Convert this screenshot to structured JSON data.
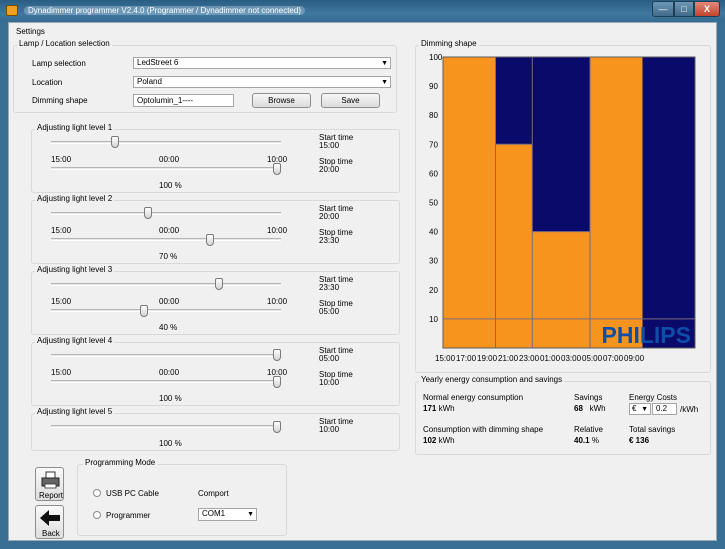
{
  "window": {
    "title": "Dynadimmer programmer V2.4.0  (Programmer / Dynadimmer not connected)",
    "controls": {
      "minimize": "—",
      "maximize": "□",
      "close": "X"
    }
  },
  "menu": {
    "settings": "Settings"
  },
  "lamp": {
    "group_title": "Lamp / Location selection",
    "lamp_label": "Lamp selection",
    "lamp_value": "LedStreet 6",
    "location_label": "Location",
    "location_value": "Poland",
    "shape_label": "Dimming shape",
    "shape_value": "Optolumin_1----",
    "browse": "Browse",
    "save": "Save"
  },
  "levels": [
    {
      "title": "Adjusting light level 1",
      "scale_left": "15:00",
      "scale_mid": "00:00",
      "scale_right": "10:00",
      "start_label": "Start time",
      "start": "15:00",
      "stop_label": "Stop time",
      "stop": "20:00",
      "percent": "100",
      "unit": "%",
      "time_pos": 0.27,
      "level_pos": 1.0
    },
    {
      "title": "Adjusting light level 2",
      "scale_left": "15:00",
      "scale_mid": "00:00",
      "scale_right": "10:00",
      "start_label": "Start time",
      "start": "20:00",
      "stop_label": "Stop time",
      "stop": "23:30",
      "percent": "70",
      "unit": "%",
      "time_pos": 0.42,
      "level_pos": 0.7
    },
    {
      "title": "Adjusting light level 3",
      "scale_left": "15:00",
      "scale_mid": "00:00",
      "scale_right": "10:00",
      "start_label": "Start time",
      "start": "23:30",
      "stop_label": "Stop time",
      "stop": "05:00",
      "percent": "40",
      "unit": "%",
      "time_pos": 0.74,
      "level_pos": 0.4
    },
    {
      "title": "Adjusting light level 4",
      "scale_left": "15:00",
      "scale_mid": "00:00",
      "scale_right": "10:00",
      "start_label": "Start time",
      "start": "05:00",
      "stop_label": "Stop time",
      "stop": "10:00",
      "percent": "100",
      "unit": "%",
      "time_pos": 1.0,
      "level_pos": 1.0
    },
    {
      "title": "Adjusting light level 5",
      "start_label": "Start time",
      "start": "10:00",
      "percent": "100",
      "unit": "%",
      "level_pos": 1.0
    }
  ],
  "programming": {
    "group_title": "Programming Mode",
    "usb": "USB PC Cable",
    "comport_label": "Comport",
    "programmer": "Programmer",
    "comport_value": "COM1",
    "report": "Report",
    "back": "Back"
  },
  "chart": {
    "group_title": "Dimming shape",
    "logo": "PHILIPS",
    "colors": {
      "orange": "#f7941d",
      "navy": "#0a0a6b",
      "line": "#7a6a80"
    }
  },
  "chart_data": {
    "type": "area",
    "x": [
      "15:00",
      "17:00",
      "19:00",
      "21:00",
      "23:00",
      "01:00",
      "03:00",
      "05:00",
      "07:00",
      "09:00"
    ],
    "y_ticks": [
      10,
      20,
      30,
      40,
      50,
      60,
      70,
      80,
      90,
      100
    ],
    "ylim": [
      0,
      100
    ],
    "segments": [
      {
        "start": "15:00",
        "stop": "20:00",
        "level": 100
      },
      {
        "start": "20:00",
        "stop": "23:30",
        "level": 70
      },
      {
        "start": "23:30",
        "stop": "05:00",
        "level": 40
      },
      {
        "start": "05:00",
        "stop": "10:00",
        "level": 100
      }
    ]
  },
  "energy": {
    "group_title": "Yearly energy consumption and savings",
    "normal_label": "Normal energy consumption",
    "normal_value": "171",
    "normal_unit": "kWh",
    "savings_label": "Savings",
    "savings_value": "68",
    "savings_unit": "kWh",
    "costs_label": "Energy Costs",
    "currency": "€",
    "cost_value": "0.2",
    "cost_unit": "/kWh",
    "dimmed_label": "Consumption with dimming shape",
    "dimmed_value": "102",
    "dimmed_unit": "kWh",
    "relative_label": "Relative",
    "relative_value": "40.1",
    "relative_unit": "%",
    "total_label": "Total savings",
    "total_value": "€ 136"
  }
}
